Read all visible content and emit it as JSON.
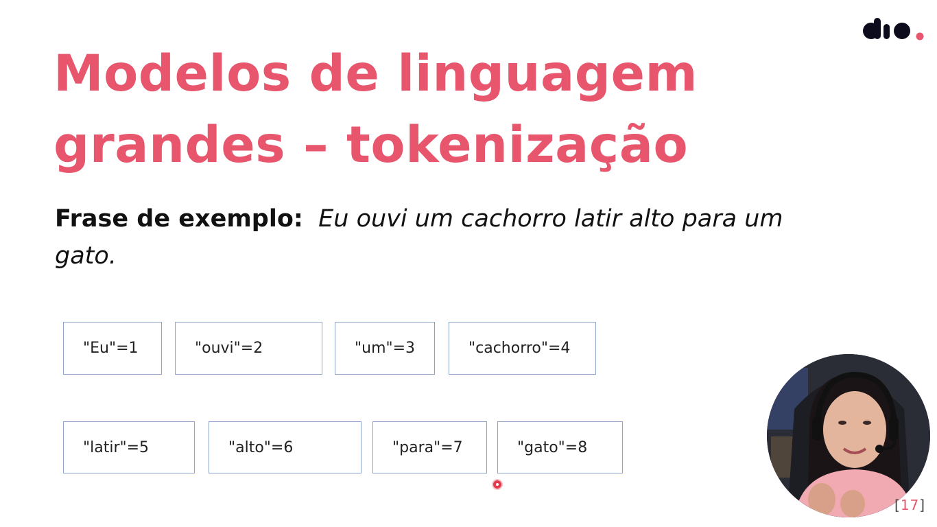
{
  "slide": {
    "title_line1": "Modelos de linguagem",
    "title_line2": "grandes – tokenização",
    "sentence_label": "Frase de exemplo:",
    "sentence_example": "Eu ouvi um cachorro latir alto para um gato.",
    "tokens": [
      "\"Eu\"=1",
      "\"ouvi\"=2",
      "\"um\"=3",
      "\"cachorro\"=4",
      "\"latir\"=5",
      "\"alto\"=6",
      "\"para\"=7",
      "\"gato\"=8"
    ],
    "page_number_open": "[",
    "page_number_value": "17",
    "page_number_close": "]"
  },
  "logo": {
    "text": "dio.",
    "accent_color": "#e8566d",
    "ink_color": "#0c0c1c"
  },
  "colors": {
    "title": "#e8566d",
    "token_border": "#8ea3cc",
    "pointer": "#e33a4e"
  },
  "icons": {
    "logo": "dio-logo",
    "pointer": "laser-pointer-dot",
    "webcam": "presenter-webcam"
  }
}
